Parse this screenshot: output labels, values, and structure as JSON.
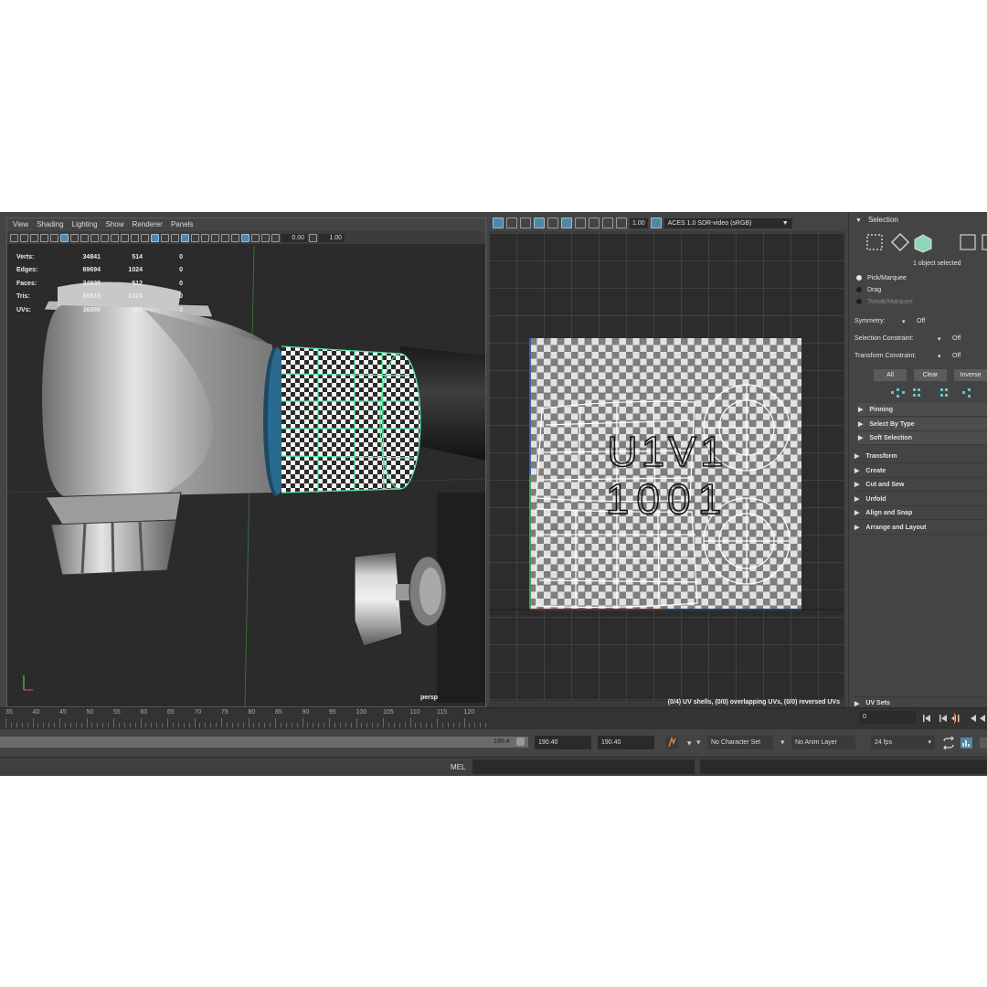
{
  "viewport": {
    "menu": [
      "View",
      "Shading",
      "Lighting",
      "Show",
      "Renderer",
      "Panels"
    ],
    "fields": [
      "0.00",
      "1.00"
    ],
    "hud": [
      {
        "label": "Verts:",
        "v1": "34841",
        "v2": "514",
        "v3": "0"
      },
      {
        "label": "Edges:",
        "v1": "69694",
        "v2": "1024",
        "v3": "0"
      },
      {
        "label": "Faces:",
        "v1": "34838",
        "v2": "512",
        "v3": "0"
      },
      {
        "label": "Tris:",
        "v1": "69610",
        "v2": "1024",
        "v3": "0"
      },
      {
        "label": "UVs:",
        "v1": "36896",
        "v2": "552",
        "v3": "0"
      }
    ],
    "camera_label": "persp"
  },
  "uv_editor": {
    "exposure_value": "1.00",
    "color_space": "ACES 1.0 SDR-video (sRGB)",
    "tile_line1": "U1V1",
    "tile_line2": "1001",
    "status": "(0/4) UV shells, (0/0) overlapping UVs, (0/0) reversed UVs",
    "checker_colors": [
      "#e6e6e6",
      "#3a3a3a"
    ],
    "uv_wire_color": "#ffffff"
  },
  "panel": {
    "title": "Selection",
    "selected_count": "1 object selected",
    "modes": [
      "Pick/Marquee",
      "Drag",
      "Tweak/Marquee"
    ],
    "symmetry_label": "Symmetry:",
    "symmetry_value": "Off",
    "sel_constraint_label": "Selection Constraint:",
    "sel_constraint_value": "Off",
    "transform_constraint_label": "Transform Constraint:",
    "transform_constraint_value": "Off",
    "btn_all": "All",
    "btn_clear": "Clear",
    "btn_inverse": "Inverse",
    "sub_sections": [
      "Pinning",
      "Select By Type",
      "Soft Selection"
    ],
    "sections": [
      "Transform",
      "Create",
      "Cut and Sew",
      "Unfold",
      "Align and Snap",
      "Arrange and Layout"
    ],
    "uv_sets": "UV Sets"
  },
  "timeline": {
    "ticks": [
      "35",
      "40",
      "45",
      "50",
      "55",
      "60",
      "65",
      "70",
      "75",
      "80",
      "85",
      "90",
      "95",
      "100",
      "105",
      "110",
      "115",
      "120"
    ],
    "current_frame": "0"
  },
  "range": {
    "end_display": "190.4",
    "end_field": "190.40",
    "max_field": "190.40",
    "character_set": "No Character Set",
    "anim_layer": "No Anim Layer",
    "fps": "24 fps"
  },
  "command": {
    "label": "MEL"
  }
}
